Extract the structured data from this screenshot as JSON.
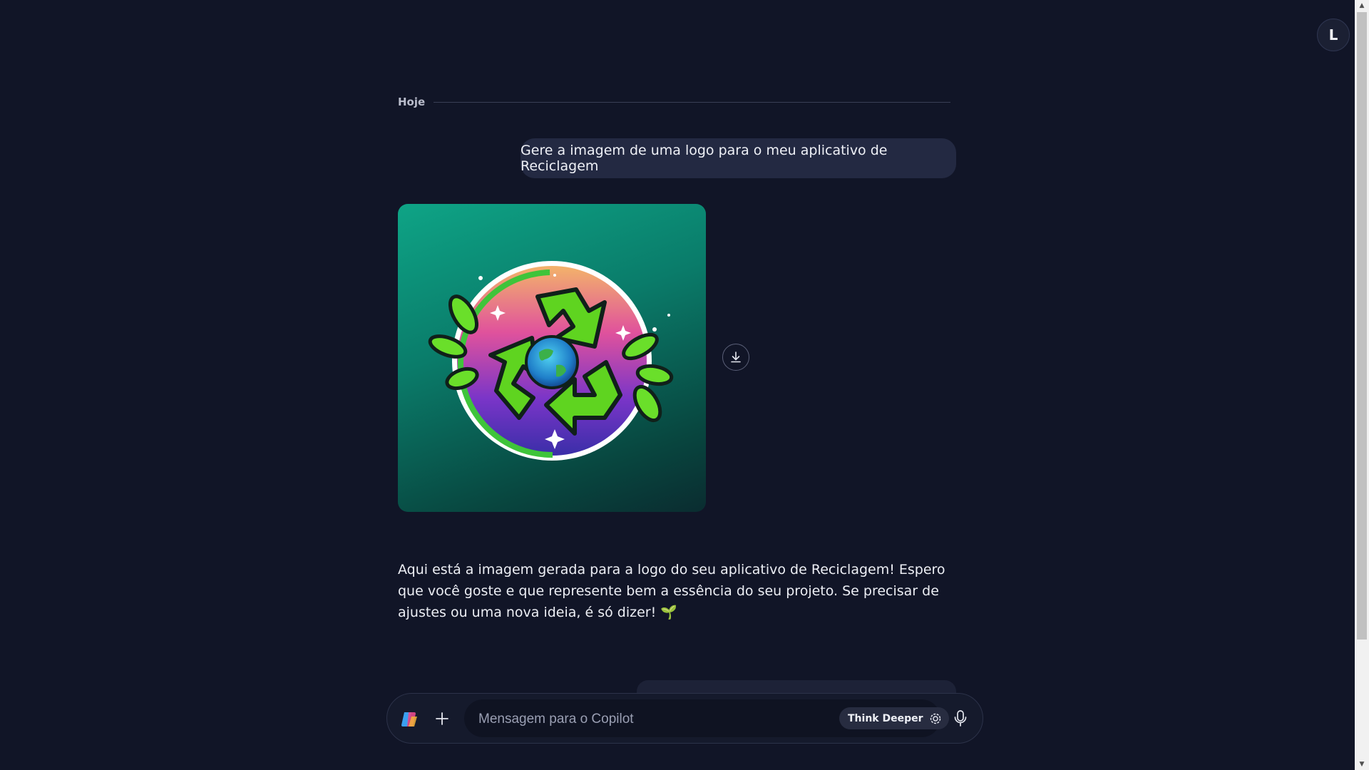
{
  "user": {
    "avatar_initial": "L"
  },
  "conversation": {
    "date_label": "Hoje",
    "user_message": "Gere a imagem de uma logo para o meu aplicativo de Reciclagem",
    "generated_image": {
      "description_icon": "recycle-logo-icon"
    },
    "assistant_reply": "Aqui está a imagem gerada para a logo do seu aplicativo de Reciclagem! Espero que você goste e que represente bem a essência do seu projeto. Se precisar de ajustes ou uma nova ideia, é só dizer! 🌱"
  },
  "composer": {
    "placeholder": "Mensagem para o Copilot",
    "think_deeper_label": "Think Deeper"
  },
  "colors": {
    "background": "#111527",
    "bubble": "#232942",
    "image_gradient_top": "#0ea486",
    "image_gradient_bottom": "#0a2c30"
  }
}
